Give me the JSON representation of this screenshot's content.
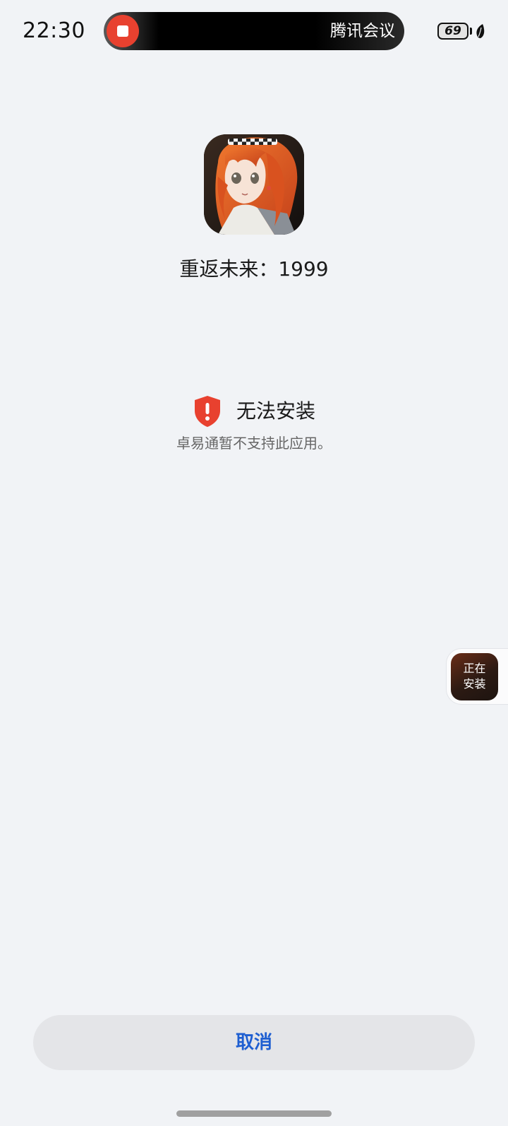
{
  "status_bar": {
    "time": "22:30",
    "meeting_label": "腾讯会议",
    "battery_level": "69",
    "recording_icon": "stop-square-icon",
    "battery_icon": "battery-icon",
    "power_saving_icon": "leaf-icon"
  },
  "app": {
    "name": "重返未来：1999",
    "icon": "app-icon-anime-girl"
  },
  "install_status": {
    "title": "无法安装",
    "description": "卓易通暂不支持此应用。",
    "icon": "shield-alert-icon",
    "icon_color": "#e8412f"
  },
  "floating_badge": {
    "line1": "正在",
    "line2": "安装"
  },
  "actions": {
    "cancel_label": "取消",
    "cancel_color": "#1f5fd1"
  }
}
